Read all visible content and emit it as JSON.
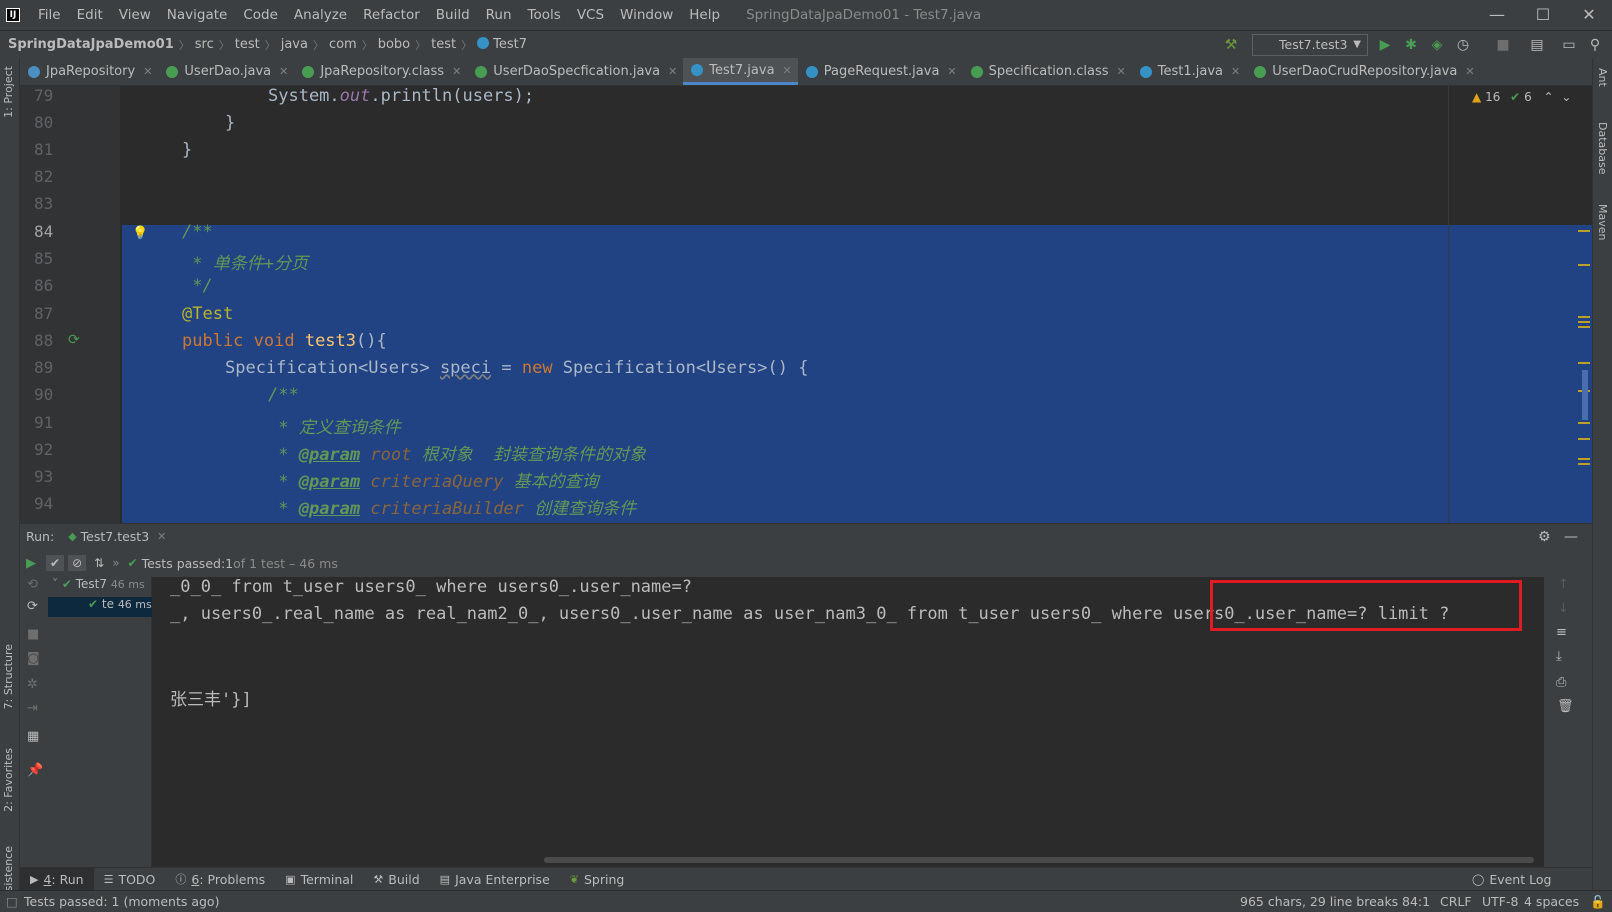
{
  "menu": {
    "items": [
      "File",
      "Edit",
      "View",
      "Navigate",
      "Code",
      "Analyze",
      "Refactor",
      "Build",
      "Run",
      "Tools",
      "VCS",
      "Window",
      "Help"
    ],
    "window_title": "SpringDataJpaDemo01 - Test7.java",
    "minimize": "—",
    "maximize": "☐",
    "close": "✕"
  },
  "breadcrumb": {
    "project": "SpringDataJpaDemo01",
    "parts": [
      "src",
      "test",
      "java",
      "com",
      "bobo",
      "test"
    ],
    "file": "Test7"
  },
  "run_config": {
    "label": "Test7.test3"
  },
  "tabs": [
    {
      "label": "JpaRepository",
      "color": "#4a8ec2"
    },
    {
      "label": "UserDao.java",
      "color": "#499c54"
    },
    {
      "label": "JpaRepository.class",
      "color": "#499c54"
    },
    {
      "label": "UserDaoSpecfication.java",
      "color": "#499c54"
    },
    {
      "label": "Test7.java",
      "color": "#3592c4"
    },
    {
      "label": "PageRequest.java",
      "color": "#3592c4"
    },
    {
      "label": "Specification.class",
      "color": "#499c54"
    },
    {
      "label": "Test1.java",
      "color": "#3592c4"
    },
    {
      "label": "UserDaoCrudRepository.java",
      "color": "#499c54"
    }
  ],
  "left_tools": [
    "1: Project",
    "7: Structure",
    "2: Favorites",
    "Persistence"
  ],
  "right_tools": [
    "Ant",
    "Database",
    "Maven"
  ],
  "editor": {
    "line_numbers": [
      "79",
      "80",
      "81",
      "82",
      "83",
      "84",
      "85",
      "86",
      "87",
      "88",
      "89",
      "90",
      "91",
      "92",
      "93",
      "94"
    ],
    "warnings": "16",
    "weak_warnings": "6",
    "line79": "System.",
    "line79_out": "out",
    "line79_rest": ".println(users);",
    "line80": "}",
    "line81": "}",
    "line84": "/**",
    "line85": " * 单条件+分页",
    "line86": " */",
    "line87": "@Test",
    "line88_kw": "public void ",
    "line88_fn": "test3",
    "line88_rest": "(){",
    "line89_a": "Specification<Users> ",
    "line89_var": "speci",
    "line89_b": " = ",
    "line89_new": "new ",
    "line89_c": "Specification<Users>() {",
    "line90": "/**",
    "line91": " * 定义查询条件",
    "line92_tag": "@param",
    "line92_p": " root",
    "line92_d": " 根对象  封装查询条件的对象",
    "line93_tag": "@param",
    "line93_p": " criteriaQuery",
    "line93_d": " 基本的查询",
    "line94_tag": "@param",
    "line94_p": " criteriaBuilder",
    "line94_d": " 创建查询条件"
  },
  "run_panel": {
    "title": "Run:",
    "tab": "Test7.test3",
    "tests_passed": "Tests passed: ",
    "passed_count": "1",
    "passed_detail": " of 1 test – 46 ms",
    "tree_root": "Test7",
    "tree_root_time": "46 ms",
    "tree_child": "te",
    "tree_child_time": "46 ms"
  },
  "console": {
    "line1": "_0_0_ from t_user users0_ where users0_.user_name=?",
    "line2": "_, users0_.real_name as real_nam2_0_, users0_.user_name as user_nam3_0_ from t_user users0_ where users0_.user_name=? limit ?",
    "line3": "",
    "line4": "张三丰'}]"
  },
  "bottom_tools": [
    {
      "key": "4",
      "label": ": Run"
    },
    {
      "key": "",
      "label": "TODO"
    },
    {
      "key": "6",
      "label": ": Problems"
    },
    {
      "key": "",
      "label": "Terminal"
    },
    {
      "key": "",
      "label": "Build"
    },
    {
      "key": "",
      "label": "Java Enterprise"
    },
    {
      "key": "",
      "label": "Spring"
    }
  ],
  "event_log": "Event Log",
  "status": {
    "message": "Tests passed: 1 (moments ago)",
    "chars": "965 chars, 29 line breaks",
    "position": "84:1",
    "line_sep": "CRLF",
    "encoding": "UTF-8",
    "indent": "4 spaces"
  }
}
